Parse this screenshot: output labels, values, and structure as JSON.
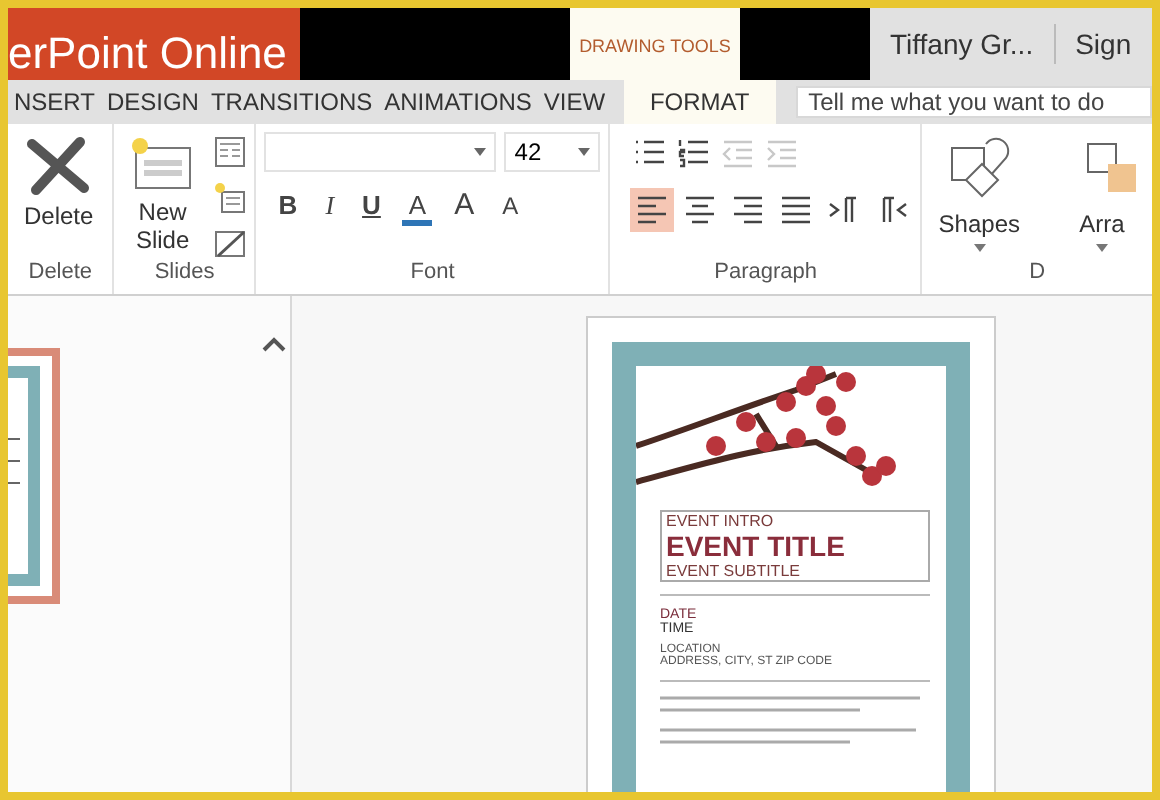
{
  "app_title": "erPoint Online",
  "context_tab": "DRAWING TOOLS",
  "user": "Tiffany Gr...",
  "sign_in": "Sign",
  "tabs": [
    {
      "label": "NSERT",
      "selected": false
    },
    {
      "label": "DESIGN",
      "selected": false
    },
    {
      "label": "TRANSITIONS",
      "selected": false
    },
    {
      "label": "ANIMATIONS",
      "selected": false
    },
    {
      "label": "VIEW",
      "selected": false
    },
    {
      "label": "FORMAT",
      "selected": true
    }
  ],
  "search": {
    "placeholder": "Tell me what you want to do"
  },
  "ribbon": {
    "delete": {
      "button": "Delete",
      "group": "Delete"
    },
    "slides": {
      "button": "New Slide",
      "group": "Slides"
    },
    "font": {
      "size": "42",
      "group": "Font",
      "styles": [
        {
          "kind": "bold",
          "label": "B"
        },
        {
          "kind": "italic",
          "label": "I"
        },
        {
          "kind": "underline",
          "label": "U"
        },
        {
          "kind": "color",
          "label": "A"
        },
        {
          "kind": "grow",
          "label": "A"
        },
        {
          "kind": "shrink",
          "label": "A"
        }
      ]
    },
    "paragraph": {
      "group": "Paragraph",
      "lists": [
        {
          "kind": "bullets",
          "disabled": false
        },
        {
          "kind": "numbering",
          "disabled": false
        },
        {
          "kind": "outdent",
          "disabled": true
        },
        {
          "kind": "indent",
          "disabled": true
        }
      ],
      "align": [
        {
          "kind": "left",
          "selected": true
        },
        {
          "kind": "center",
          "selected": false
        },
        {
          "kind": "right",
          "selected": false
        },
        {
          "kind": "justify",
          "selected": false
        },
        {
          "kind": "ltr",
          "selected": false
        },
        {
          "kind": "rtl",
          "selected": false
        }
      ]
    },
    "drawing": {
      "shapes": "Shapes",
      "arrange": "Arra",
      "group": "D"
    }
  },
  "slide": {
    "intro": "EVENT INTRO",
    "title": "EVENT TITLE",
    "subtitle": "EVENT SUBTITLE",
    "date": "DATE",
    "time": "TIME",
    "location": "LOCATION",
    "address": "ADDRESS, CITY, ST ZIP CODE"
  }
}
